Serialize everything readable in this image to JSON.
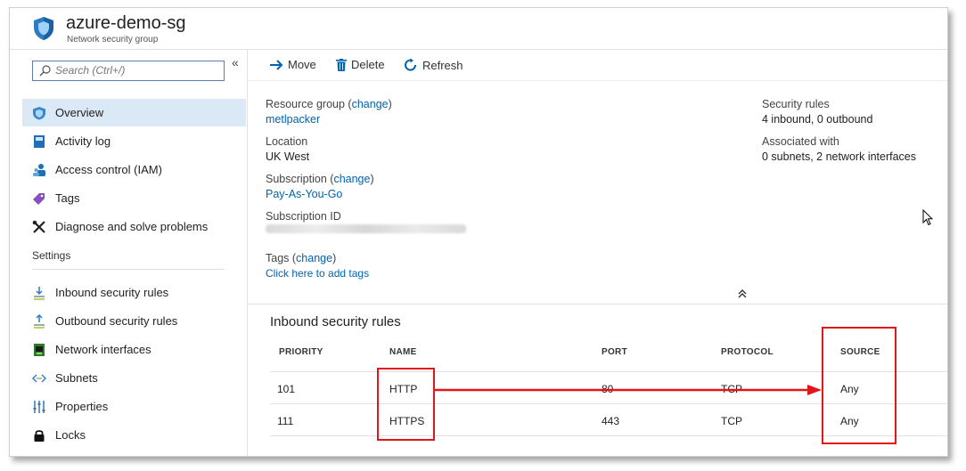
{
  "header": {
    "title": "azure-demo-sg",
    "subtitle": "Network security group"
  },
  "sidebar": {
    "search": {
      "placeholder": "Search (Ctrl+/)",
      "value": ""
    },
    "collapse_glyph": "«",
    "items": [
      {
        "label": "Overview",
        "icon": "shield-icon",
        "active": true
      },
      {
        "label": "Activity log",
        "icon": "book-icon"
      },
      {
        "label": "Access control (IAM)",
        "icon": "users-icon"
      },
      {
        "label": "Tags",
        "icon": "tag-icon"
      },
      {
        "label": "Diagnose and solve problems",
        "icon": "wrench-icon"
      }
    ],
    "settings_label": "Settings",
    "settings_items": [
      {
        "label": "Inbound security rules",
        "icon": "inbound-rules-icon"
      },
      {
        "label": "Outbound security rules",
        "icon": "outbound-rules-icon"
      },
      {
        "label": "Network interfaces",
        "icon": "network-interface-icon"
      },
      {
        "label": "Subnets",
        "icon": "subnet-icon"
      },
      {
        "label": "Properties",
        "icon": "properties-icon"
      },
      {
        "label": "Locks",
        "icon": "lock-icon"
      }
    ]
  },
  "toolbar": {
    "move_label": "Move",
    "delete_label": "Delete",
    "refresh_label": "Refresh"
  },
  "essentials": {
    "resource_group": {
      "label": "Resource group",
      "change": "change",
      "value": "metlpacker"
    },
    "location": {
      "label": "Location",
      "value": "UK West"
    },
    "subscription": {
      "label": "Subscription",
      "change": "change",
      "value": "Pay-As-You-Go"
    },
    "subscription_id": {
      "label": "Subscription ID"
    },
    "tags": {
      "label": "Tags",
      "change": "change",
      "value": "Click here to add tags"
    },
    "security_rules": {
      "label": "Security rules",
      "value": "4 inbound, 0 outbound"
    },
    "associated_with": {
      "label": "Associated with",
      "value": "0 subnets, 2 network interfaces"
    }
  },
  "inbound": {
    "title": "Inbound security rules",
    "columns": [
      "PRIORITY",
      "NAME",
      "PORT",
      "PROTOCOL",
      "SOURCE"
    ],
    "rows": [
      [
        "101",
        "HTTP",
        "80",
        "TCP",
        "Any"
      ],
      [
        "111",
        "HTTPS",
        "443",
        "TCP",
        "Any"
      ]
    ]
  },
  "colors": {
    "accent": "#0063b1",
    "highlight": "#e4141b",
    "active_nav": "#dbe9f6"
  }
}
